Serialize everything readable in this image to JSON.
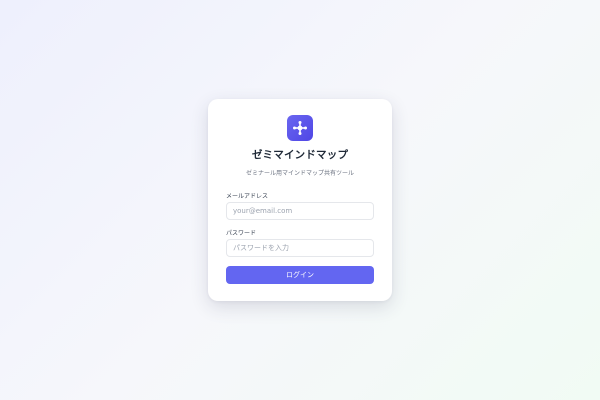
{
  "app": {
    "title": "ゼミマインドマップ",
    "subtitle": "ゼミナール用マインドマップ共有ツール",
    "logo_icon": "mindmap-node-icon",
    "accent_color": "#6366f1"
  },
  "form": {
    "email_label": "メールアドレス",
    "email_placeholder": "your@email.com",
    "email_value": "",
    "password_label": "パスワード",
    "password_placeholder": "パスワードを入力",
    "password_value": "",
    "submit_label": "ログイン"
  }
}
